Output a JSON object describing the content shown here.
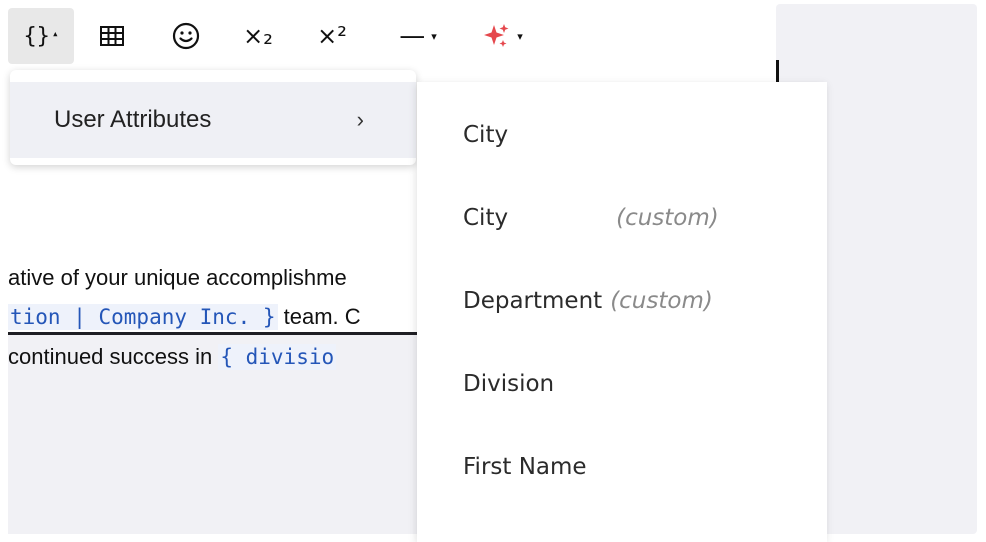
{
  "toolbar": {
    "variable_button_glyph": "{}",
    "variable_caret": "▴",
    "subscript_glyph": "×₂",
    "superscript_glyph": "×²",
    "hr_glyph": "—",
    "dropdown_caret": "▾",
    "ai_color": "#e5484d"
  },
  "editor": {
    "line1": "ative of your unique accomplishme",
    "line2_token": "tion | Company Inc. }",
    "line2_text": " team. C",
    "line3_text": "continued success in ",
    "line3_token": "{ divisio"
  },
  "menu": {
    "items": [
      {
        "label": "User Attributes",
        "chevron": "›"
      }
    ]
  },
  "submenu": {
    "items": [
      {
        "label": "City",
        "tag": ""
      },
      {
        "label": "City",
        "tag": "(custom)"
      },
      {
        "label": "Department",
        "tag": "(custom)"
      },
      {
        "label": "Division",
        "tag": ""
      },
      {
        "label": "First Name",
        "tag": ""
      }
    ]
  }
}
